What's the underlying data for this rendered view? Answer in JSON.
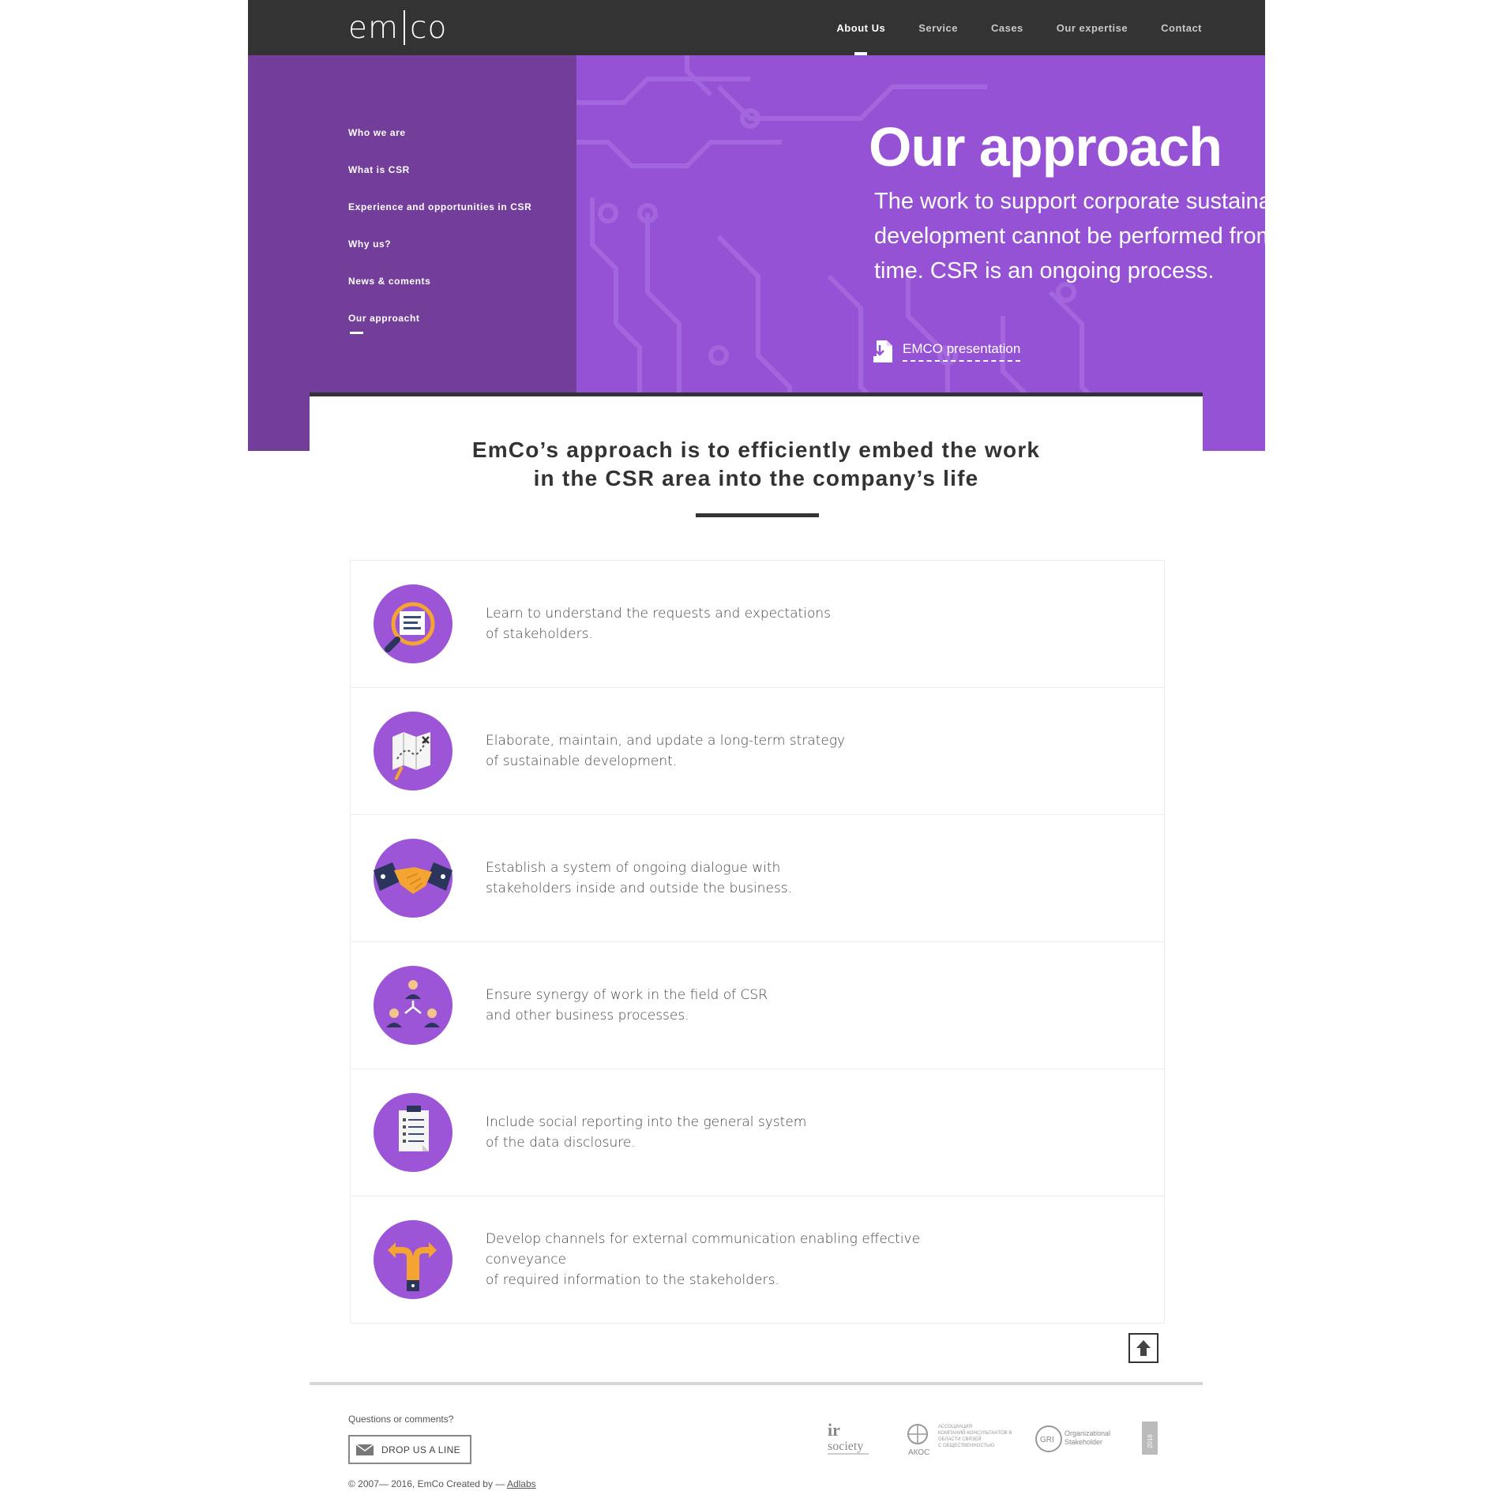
{
  "brand": {
    "logo_left": "em",
    "logo_right": "co"
  },
  "nav": [
    {
      "label": "About Us",
      "active": true
    },
    {
      "label": "Service"
    },
    {
      "label": "Cases"
    },
    {
      "label": "Our expertise"
    },
    {
      "label": "Contact"
    }
  ],
  "sidebar": [
    {
      "label": "Who we are"
    },
    {
      "label": "What is CSR"
    },
    {
      "label": "Experience and opportunities in CSR"
    },
    {
      "label": "Why us?"
    },
    {
      "label": "News & coments"
    },
    {
      "label": "Our approacht",
      "active": true
    }
  ],
  "hero": {
    "title": "Our approach",
    "subtitle": "The work to support corporate sustainable development cannot be performed from time to time. CSR is an ongoing process.",
    "presentation_label": "EMCO presentation"
  },
  "intro": {
    "line1": "EmCo’s approach is to efficiently embed the work",
    "line2": "in the CSR area into the company’s life"
  },
  "approach_items": [
    {
      "icon": "magnifier-document-icon",
      "line1": "Learn to understand the requests and expectations",
      "line2": "of stakeholders."
    },
    {
      "icon": "strategy-map-icon",
      "line1": "Elaborate, maintain, and update a long-term strategy",
      "line2": "of sustainable development."
    },
    {
      "icon": "handshake-icon",
      "line1": "Establish a system of ongoing dialogue with",
      "line2": "stakeholders inside and outside the business."
    },
    {
      "icon": "team-synergy-icon",
      "line1": "Ensure synergy of work in the field of CSR",
      "line2": "and other business processes."
    },
    {
      "icon": "clipboard-report-icon",
      "line1": "Include social reporting into the general system",
      "line2": "of the data disclosure."
    },
    {
      "icon": "signpost-arrows-icon",
      "line1": "Develop channels for external communication enabling effective conveyance",
      "line2": "of required information to the stakeholders."
    }
  ],
  "footer": {
    "question": "Questions or comments?",
    "drop_label": "DROP US A LINE",
    "copyright": "© 2007— 2016, EmCo   Created by — ",
    "creator": "Adlabs",
    "partners": {
      "ir_top": "ir",
      "ir_bottom": "society",
      "akos_name": "АКОС",
      "akos_text1": "АССОЦИАЦИЯ",
      "akos_text2": "КОМПАНИЙ-КОНСУЛЬТАНТОВ В",
      "akos_text3": "ОБЛАСТИ СВЯЗЕЙ",
      "akos_text4": "С ОБЩЕСТВЕННОСТЬЮ",
      "gri_mark": "GRI",
      "gri_text1": "Organizational",
      "gri_text2": "Stakeholder",
      "year": "2016"
    }
  },
  "colors": {
    "header": "#333333",
    "purple_dark": "#733e9a",
    "purple": "#9552d4",
    "icon_circle": "#9b55d6",
    "accent_orange": "#f4a531"
  }
}
